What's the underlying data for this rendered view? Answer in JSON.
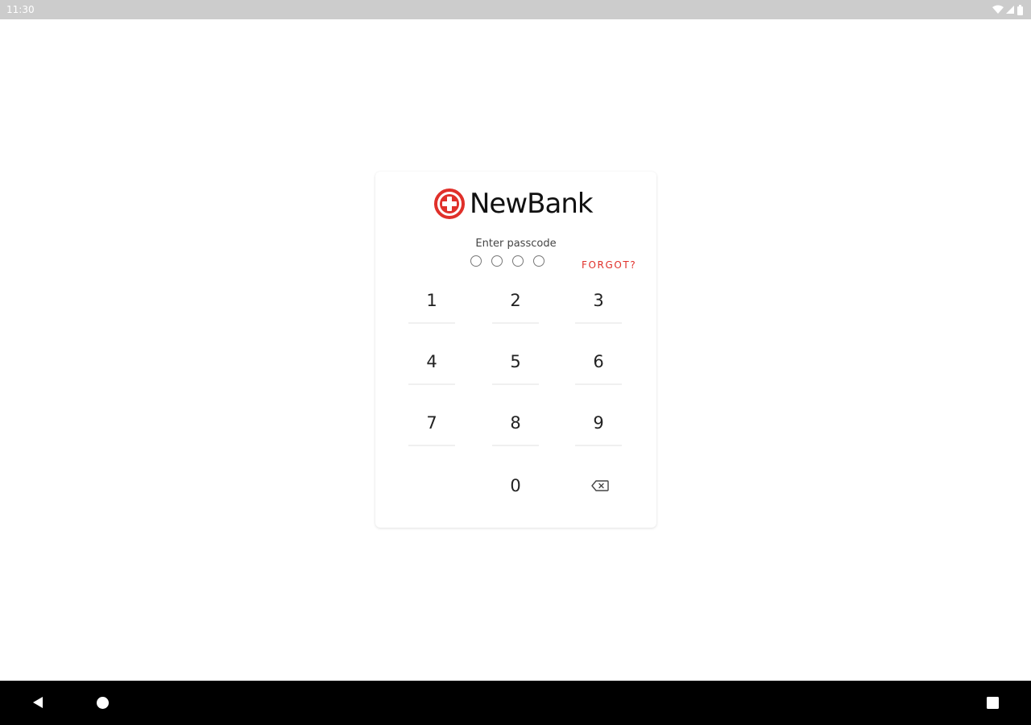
{
  "status_bar": {
    "time": "11:30",
    "icons": [
      "wifi-icon",
      "signal-icon",
      "battery-icon"
    ]
  },
  "brand": {
    "name": "NewBank",
    "logo": "newbank-logo-icon",
    "accent_color": "#e0302a"
  },
  "passcode": {
    "prompt": "Enter passcode",
    "length": 4,
    "entered": 0,
    "forgot_label": "FORGOT?"
  },
  "keypad": {
    "keys": [
      "1",
      "2",
      "3",
      "4",
      "5",
      "6",
      "7",
      "8",
      "9",
      "0"
    ],
    "backspace_icon": "backspace-icon"
  },
  "nav_bar": {
    "buttons": [
      "back-icon",
      "home-icon",
      "recents-icon"
    ]
  }
}
